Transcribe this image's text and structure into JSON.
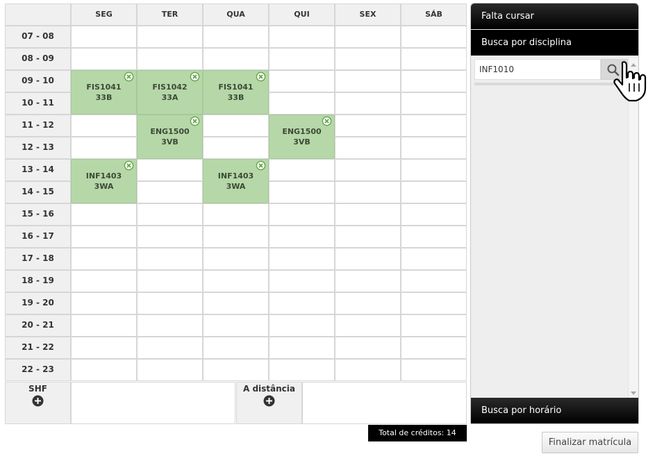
{
  "days": [
    "SEG",
    "TER",
    "QUA",
    "QUI",
    "SEX",
    "SÁB"
  ],
  "times": [
    "07 - 08",
    "08 - 09",
    "09 - 10",
    "10 - 11",
    "11 - 12",
    "12 - 13",
    "13 - 14",
    "14 - 15",
    "15 - 16",
    "16 - 17",
    "17 - 18",
    "18 - 19",
    "19 - 20",
    "20 - 21",
    "21 - 22",
    "22 - 23"
  ],
  "courses": [
    {
      "code": "FIS1041",
      "class": "33B",
      "day": 0,
      "start": 2,
      "span": 2
    },
    {
      "code": "FIS1042",
      "class": "33A",
      "day": 1,
      "start": 2,
      "span": 2
    },
    {
      "code": "FIS1041",
      "class": "33B",
      "day": 2,
      "start": 2,
      "span": 2
    },
    {
      "code": "ENG1500",
      "class": "3VB",
      "day": 1,
      "start": 4,
      "span": 2
    },
    {
      "code": "ENG1500",
      "class": "3VB",
      "day": 3,
      "start": 4,
      "span": 2
    },
    {
      "code": "INF1403",
      "class": "3WA",
      "day": 0,
      "start": 6,
      "span": 2
    },
    {
      "code": "INF1403",
      "class": "3WA",
      "day": 2,
      "start": 6,
      "span": 2
    }
  ],
  "bottom": {
    "shf_label": "SHF",
    "distance_label": "A distância"
  },
  "credits_text": "Total de créditos: 14",
  "panel": {
    "falta_cursar": "Falta cursar",
    "busca_disciplina": "Busca por disciplina",
    "busca_horario": "Busca por horário",
    "search_value": "INF1010"
  },
  "finalize_label": "Finalizar matrícula",
  "icons": {
    "remove": "remove-circle-icon",
    "add": "plus-circle-icon",
    "search": "magnifier-icon",
    "cursor": "hand-pointer-icon"
  },
  "colors": {
    "course_bg": "#b6d7a8",
    "remove_icon": "#6aa84f",
    "header_bg": "#f0f0f0",
    "bar_bg": "#000000"
  }
}
